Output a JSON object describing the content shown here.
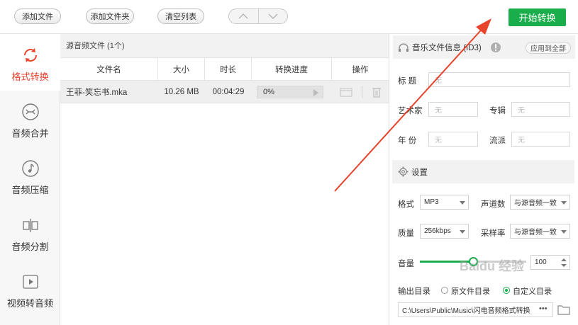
{
  "toolbar": {
    "add_file": "添加文件",
    "add_folder": "添加文件夹",
    "clear_list": "清空列表",
    "nav_up": "︿",
    "nav_down": "﹀",
    "start": "开始转换",
    "accent_color": "#1aad4b"
  },
  "sidebar": {
    "items": [
      {
        "label": "格式转换",
        "icon": "refresh-icon",
        "active": true
      },
      {
        "label": "音频合并",
        "icon": "merge-icon"
      },
      {
        "label": "音频压缩",
        "icon": "music-note-icon"
      },
      {
        "label": "音频分割",
        "icon": "split-icon"
      },
      {
        "label": "视频转音频",
        "icon": "play-icon"
      }
    ],
    "active_color": "#e8432d"
  },
  "file_list": {
    "title": "源音频文件 (1个)",
    "columns": [
      "文件名",
      "大小",
      "时长",
      "转换进度",
      "操作"
    ],
    "rows": [
      {
        "name": "王菲-笑忘书.mka",
        "size": "10.26 MB",
        "duration": "00:04:29",
        "progress": "0%",
        "progress_value": 0
      }
    ]
  },
  "music_info": {
    "title": "音乐文件信息 (ID3)",
    "apply_all": "应用到全部",
    "fields": {
      "title_label": "标  题",
      "title_value": "无",
      "artist_label": "艺术家",
      "artist_value": "无",
      "album_label": "专辑",
      "album_value": "无",
      "year_label": "年  份",
      "year_value": "无",
      "genre_label": "流派",
      "genre_value": "无"
    }
  },
  "settings": {
    "title": "设置",
    "format_label": "格式",
    "format_value": "MP3",
    "channels_label": "声道数",
    "channels_value": "与源音频一致",
    "quality_label": "质量",
    "quality_value": "256kbps",
    "samplerate_label": "采样率",
    "samplerate_value": "与源音频一致",
    "volume_label": "音量",
    "volume_value": "100",
    "volume_level": 0.5,
    "output_label": "输出目录",
    "output_opt_source": "原文件目录",
    "output_opt_custom": "自定义目录",
    "output_path": "C:\\Users\\Public\\Music\\闪电音频格式转换",
    "browse": "•••"
  },
  "watermark": "Baidu 经验"
}
